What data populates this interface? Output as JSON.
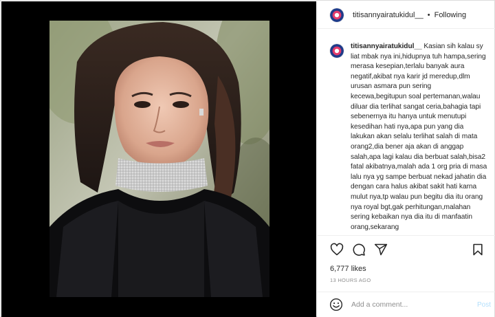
{
  "post": {
    "username": "titisannyairatukidul__",
    "follow_label": "Following",
    "dot": "•",
    "caption_username": "titisannyairatukidul__",
    "caption_body": "Kasian sih kalau sy liat mbak nya ini,hidupnya tuh hampa,sering merasa kesepian,terlalu banyak aura negatif,akibat nya karir jd meredup,dlm urusan asmara pun sering kecewa,begitupun soal pertemanan,walau diluar dia terlihat sangat ceria,bahagia tapi sebenernya itu hanya untuk menutupi kesedihan hati nya,apa pun yang dia lakukan akan selalu terlihat salah di mata orang2,dia bener aja akan di anggap salah,apa lagi kalau dia berbuat salah,bisa2 fatal akibatnya,malah ada 1 org pria di masa lalu nya yg sampe berbuat nekad jahatin dia dengan cara halus akibat sakit hati karna mulut nya,tp walau pun begitu dia itu orang nya royal bgt,gak perhitungan,malahan sering kebaikan nya dia itu di manfaatin orang,sekarang",
    "likes": "6,777 likes",
    "timestamp": "13 HOURS AGO"
  },
  "comment": {
    "placeholder": "Add a comment...",
    "post_label": "Post"
  },
  "icons": {
    "like": "heart-icon",
    "comment": "comment-icon",
    "share": "share-icon",
    "save": "bookmark-icon",
    "emoji": "emoji-icon"
  },
  "colors": {
    "post_button": "#b2dffc",
    "muted_text": "#8e8e8e",
    "border": "#dbdbdb"
  }
}
